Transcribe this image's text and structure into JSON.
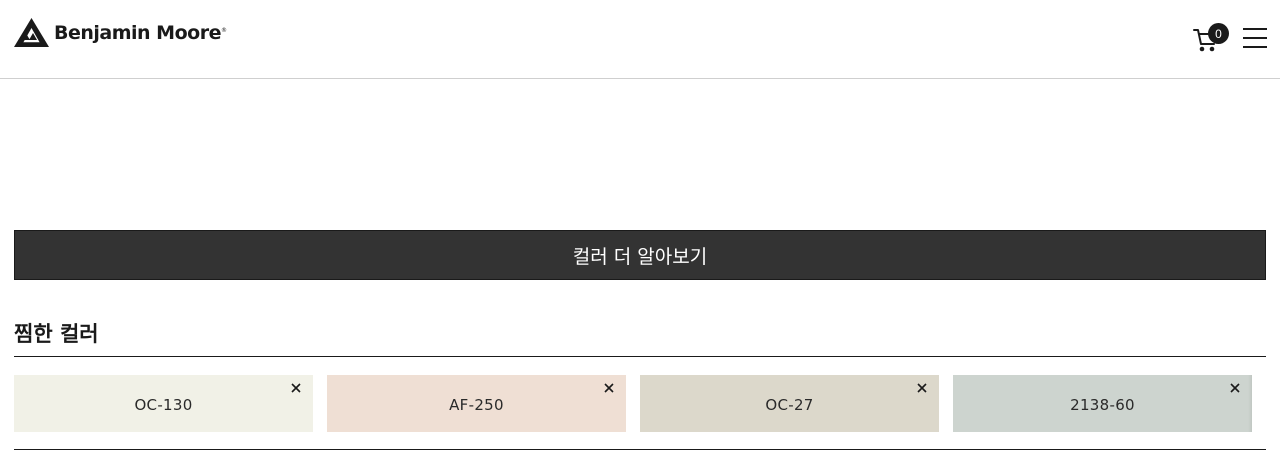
{
  "header": {
    "brand_name": "Benjamin Moore",
    "brand_mark": "®",
    "cart_count": "0",
    "icons": {
      "logo": "mountain-logo-icon",
      "cart": "cart-icon",
      "menu": "hamburger-menu-icon"
    }
  },
  "cta": {
    "label": "컬러 더 알아보기"
  },
  "favorites": {
    "title": "찜한 컬러",
    "swatches": [
      {
        "code": "OC-130",
        "color": "#f1f1e7"
      },
      {
        "code": "AF-250",
        "color": "#efdfd4"
      },
      {
        "code": "OC-27",
        "color": "#dcd8cb"
      },
      {
        "code": "2138-60",
        "color": "#cdd4cf"
      }
    ],
    "remove_icon": "close-icon"
  }
}
